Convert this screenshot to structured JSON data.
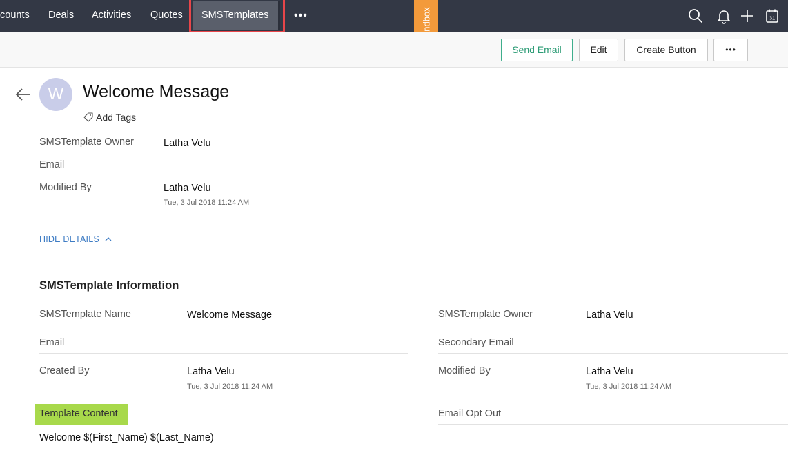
{
  "nav": {
    "tabs": [
      "counts",
      "Deals",
      "Activities",
      "Quotes",
      "SMSTemplates"
    ],
    "more": "•••",
    "sandbox": "Sandbox",
    "icons": [
      "search-icon",
      "bell-icon",
      "plus-icon",
      "calendar-icon"
    ],
    "calendar_day": "31"
  },
  "toolbar": {
    "send_email": "Send Email",
    "edit": "Edit",
    "create_button": "Create Button",
    "more": "•••"
  },
  "record": {
    "avatar_letter": "W",
    "title": "Welcome Message",
    "add_tags": "Add Tags"
  },
  "summary": {
    "owner_label": "SMSTemplate Owner",
    "owner_value": "Latha Velu",
    "email_label": "Email",
    "modified_label": "Modified By",
    "modified_value": "Latha Velu",
    "modified_time": "Tue, 3 Jul 2018 11:24 AM",
    "hide_details": "HIDE DETAILS"
  },
  "info": {
    "section_title": "SMSTemplate Information",
    "left": {
      "name_label": "SMSTemplate Name",
      "name_value": "Welcome Message",
      "email_label": "Email",
      "created_label": "Created By",
      "created_value": "Latha Velu",
      "created_time": "Tue, 3 Jul 2018 11:24 AM",
      "content_label": "Template Content",
      "content_value": "Welcome $(First_Name) $(Last_Name)"
    },
    "right": {
      "owner_label": "SMSTemplate Owner",
      "owner_value": "Latha Velu",
      "secondary_email_label": "Secondary Email",
      "modified_label": "Modified By",
      "modified_value": "Latha Velu",
      "modified_time": "Tue, 3 Jul 2018 11:24 AM",
      "opt_out_label": "Email Opt Out"
    }
  },
  "colors": {
    "nav_bg": "#333845",
    "highlight_border": "#e8464a",
    "sandbox": "#f39a3b",
    "accent_green": "#2d9c76",
    "link_blue": "#3e7cc4",
    "content_highlight": "#a8d94b"
  }
}
